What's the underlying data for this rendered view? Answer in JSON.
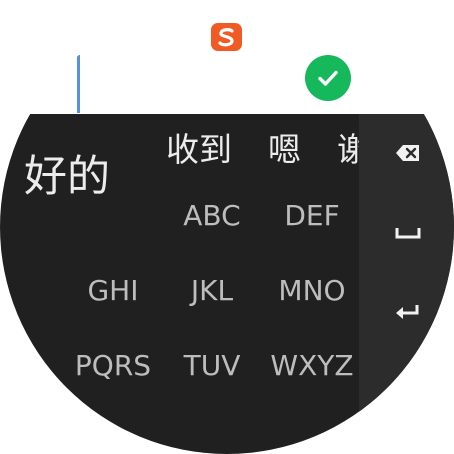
{
  "composing": {
    "text": "好的"
  },
  "candidates": [
    "收到",
    "嗯",
    "谢"
  ],
  "keys": {
    "row1": [
      "ABC",
      "DEF"
    ],
    "row2": [
      "GHI",
      "JKL",
      "MNO"
    ],
    "row3": [
      "PQRS",
      "TUV",
      "WXYZ"
    ]
  },
  "icons": {
    "brand": "sogou-logo-icon",
    "confirm": "checkmark-icon",
    "backspace": "backspace-icon",
    "space": "space-icon",
    "enter": "enter-icon"
  },
  "colors": {
    "brand": "#f05a24",
    "confirm": "#16b85c",
    "cursor": "#5a8fe0",
    "keyboard_bg": "#202020",
    "side_column_bg": "#2c2c2c"
  }
}
